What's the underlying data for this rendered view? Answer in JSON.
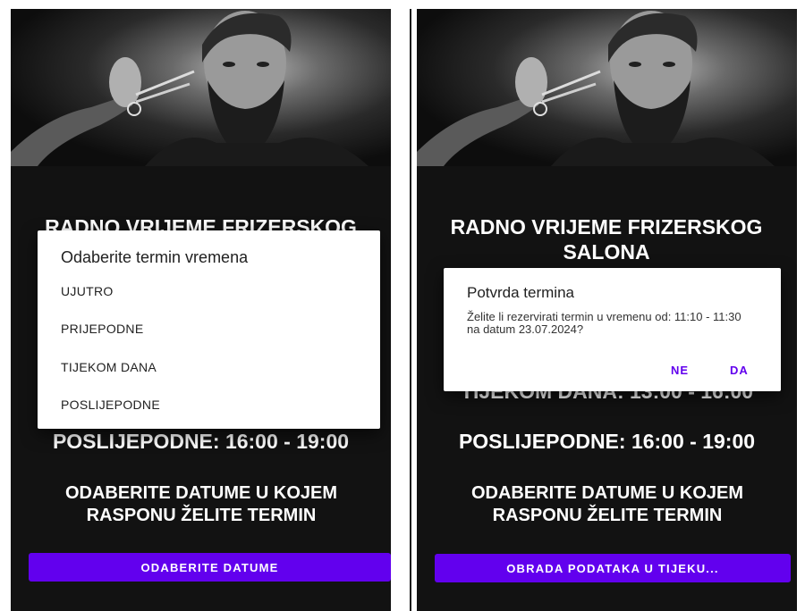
{
  "left_screen": {
    "heading_top": "RADNO VRIJEME FRIZERSKOG",
    "visible_hours": "POSLIJEPODNE: 16:00 - 19:00",
    "instruction": "ODABERITE DATUME U KOJEM RASPONU ŽELITE TERMIN",
    "button_label": "ODABERITE DATUME",
    "dialog": {
      "title": "Odaberite termin vremena",
      "options": [
        "UJUTRO",
        "PRIJEPODNE",
        "TIJEKOM DANA",
        "POSLIJEPODNE"
      ]
    }
  },
  "right_screen": {
    "heading": "RADNO VRIJEME FRIZERSKOG SALONA",
    "partial_hours": "TIJEKOM DANA: 13:00 - 16:00",
    "visible_hours": "POSLIJEPODNE: 16:00 - 19:00",
    "instruction": "ODABERITE DATUME U KOJEM RASPONU ŽELITE TERMIN",
    "button_label": "OBRADA PODATAKA U TIJEKU...",
    "dialog": {
      "title": "Potvrda termina",
      "message": "Želite li rezervirati termin u vremenu od: 11:10 - 11:30 na datum 23.07.2024?",
      "negative_label": "NE",
      "positive_label": "DA"
    }
  },
  "colors": {
    "accent": "#6200ee",
    "screen_background": "#121212",
    "dialog_background": "#ffffff"
  }
}
